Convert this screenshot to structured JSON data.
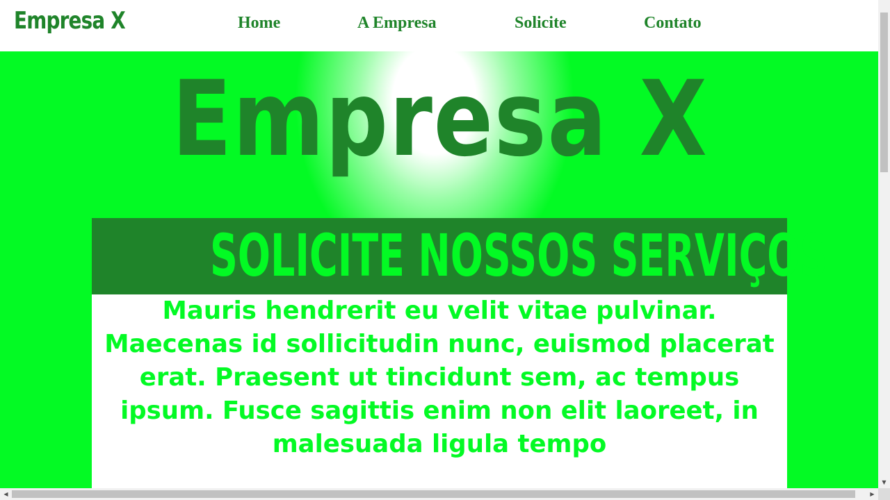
{
  "nav": {
    "brand": "Empresa X",
    "links": [
      "Home",
      "A Empresa",
      "Solicite",
      "Contato"
    ]
  },
  "hero": {
    "title": "Empresa X"
  },
  "services": {
    "heading": "SOLICITE NOSSOS SERVIÇOS",
    "text": "Mauris hendrerit eu velit vitae pulvinar. Maecenas id sollicitudin nunc, euismod placerat erat. Praesent ut tincidunt sem, ac tempus ipsum. Fusce sagittis enim non elit laoreet, in malesuada ligula tempo"
  },
  "scrollbars": {
    "up_icon": "arrow-up-icon",
    "down_icon": "arrow-down-icon",
    "left_icon": "arrow-left-icon",
    "right_icon": "arrow-right-icon"
  },
  "colors": {
    "dark_green": "#1f842a",
    "bright_green": "#03fa24",
    "white": "#ffffff"
  }
}
